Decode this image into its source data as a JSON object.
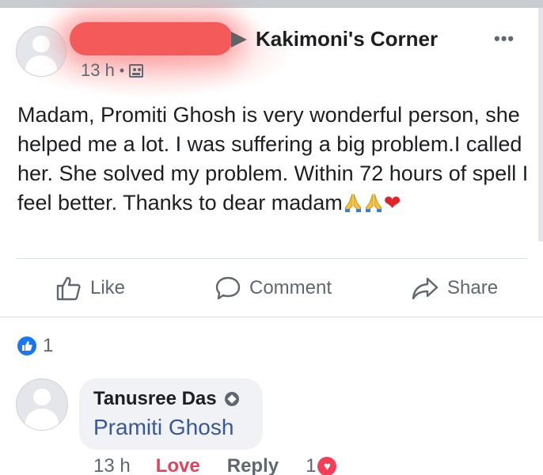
{
  "post": {
    "group_name": "Kakimoni's Corner",
    "time": "13 h",
    "separator": "•",
    "more_label": "•••",
    "text": "Madam, Promiti Ghosh is very wonderful person, she helped me a lot. I was suffering a big problem.I called her. She solved my problem. Within 72 hours of spell I feel better. Thanks to dear madam",
    "trailing_emojis": [
      "folded-hands",
      "folded-hands",
      "red-heart"
    ]
  },
  "actions": {
    "like_label": "Like",
    "comment_label": "Comment",
    "share_label": "Share"
  },
  "reactions": {
    "count": "1",
    "type": "like"
  },
  "comment": {
    "author": "Tanusree Das",
    "mention": "Pramiti Ghosh",
    "time": "13 h",
    "love_label": "Love",
    "reply_label": "Reply",
    "reaction_count": "1",
    "reaction_type": "love"
  },
  "colors": {
    "link": "#385898",
    "love": "#e4405f",
    "like_badge": "#1877f2",
    "heart": "#e0242a"
  }
}
